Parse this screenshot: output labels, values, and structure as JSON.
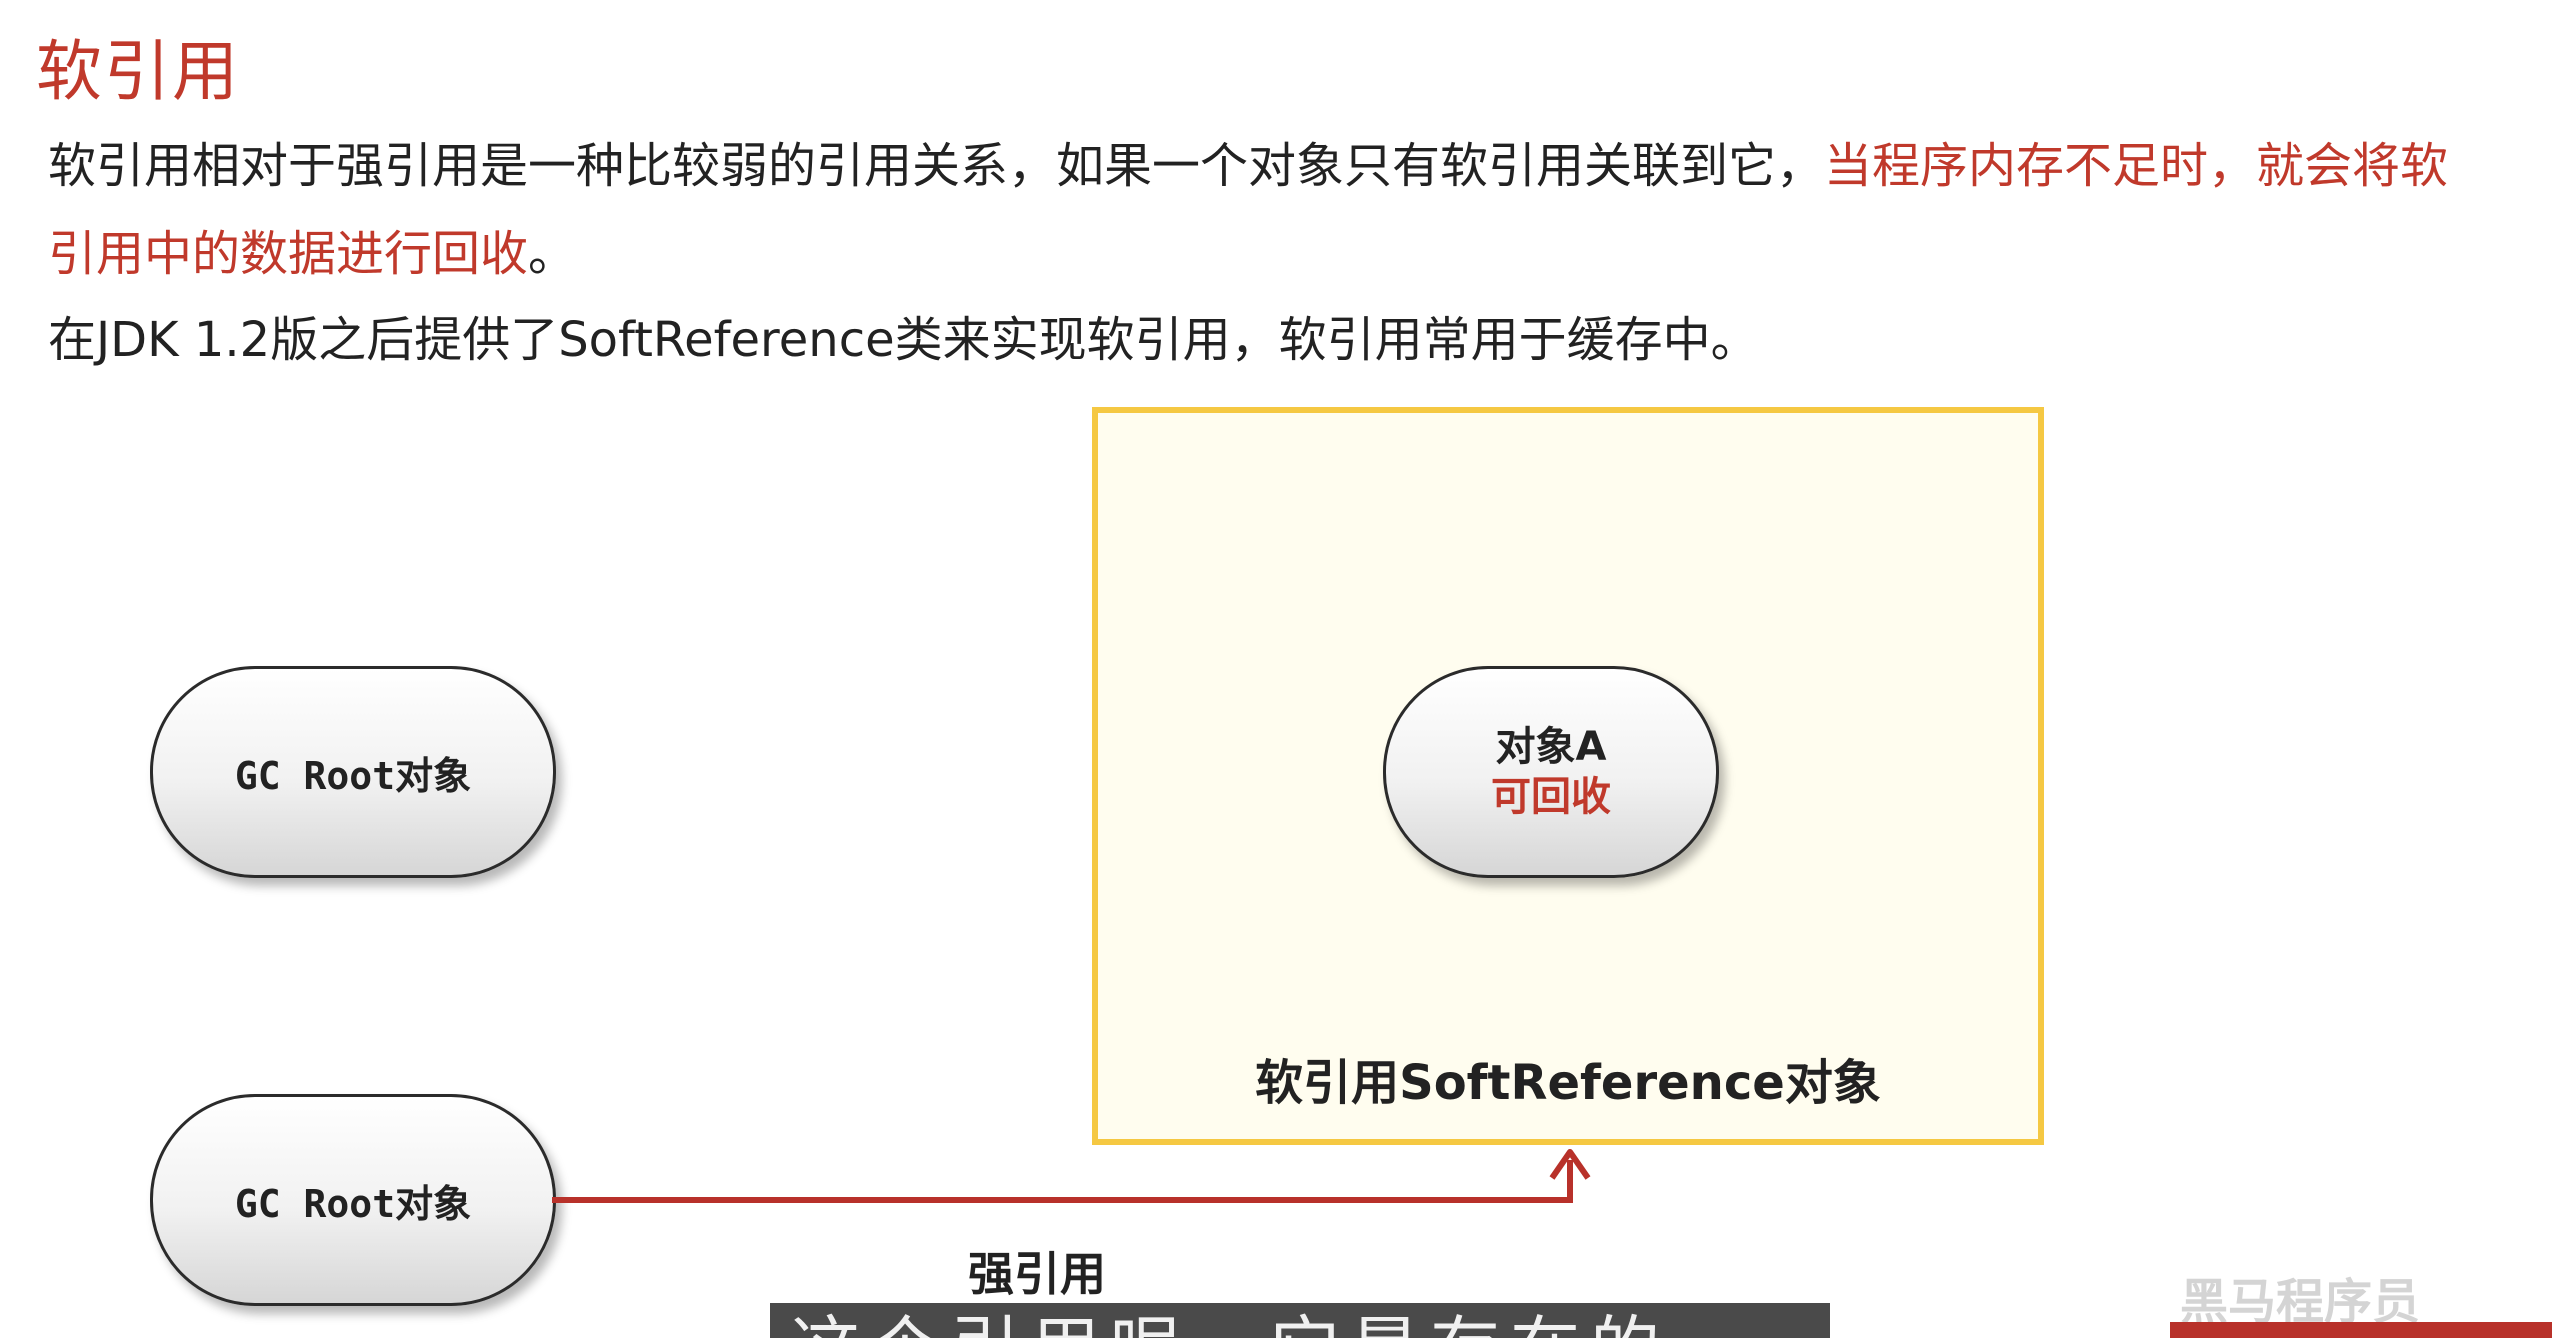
{
  "title": "软引用",
  "paragraph1": {
    "normal": "软引用相对于强引用是一种比较弱的引用关系，如果一个对象只有软引用关联到它，",
    "highlight_line1": "当程序内存不足时，就会将软",
    "highlight_line2": "引用中的数据进行回收",
    "end": "。"
  },
  "paragraph2": "在JDK 1.2版之后提供了SoftReference类来实现软引用，软引用常用于缓存中。",
  "diagram": {
    "gc_root_top": "GC Root对象",
    "gc_root_bottom": "GC Root对象",
    "container_label": "软引用SoftReference对象",
    "object_a": {
      "name": "对象A",
      "status": "可回收"
    },
    "edge_label": "强引用"
  },
  "subtitle": "这个引用呢，它是存在的",
  "watermark": "黑马程序员",
  "colors": {
    "accent_red": "#c0392b",
    "container_border": "#f5c842",
    "container_fill": "#fffdef",
    "arrow": "#b8312a"
  }
}
